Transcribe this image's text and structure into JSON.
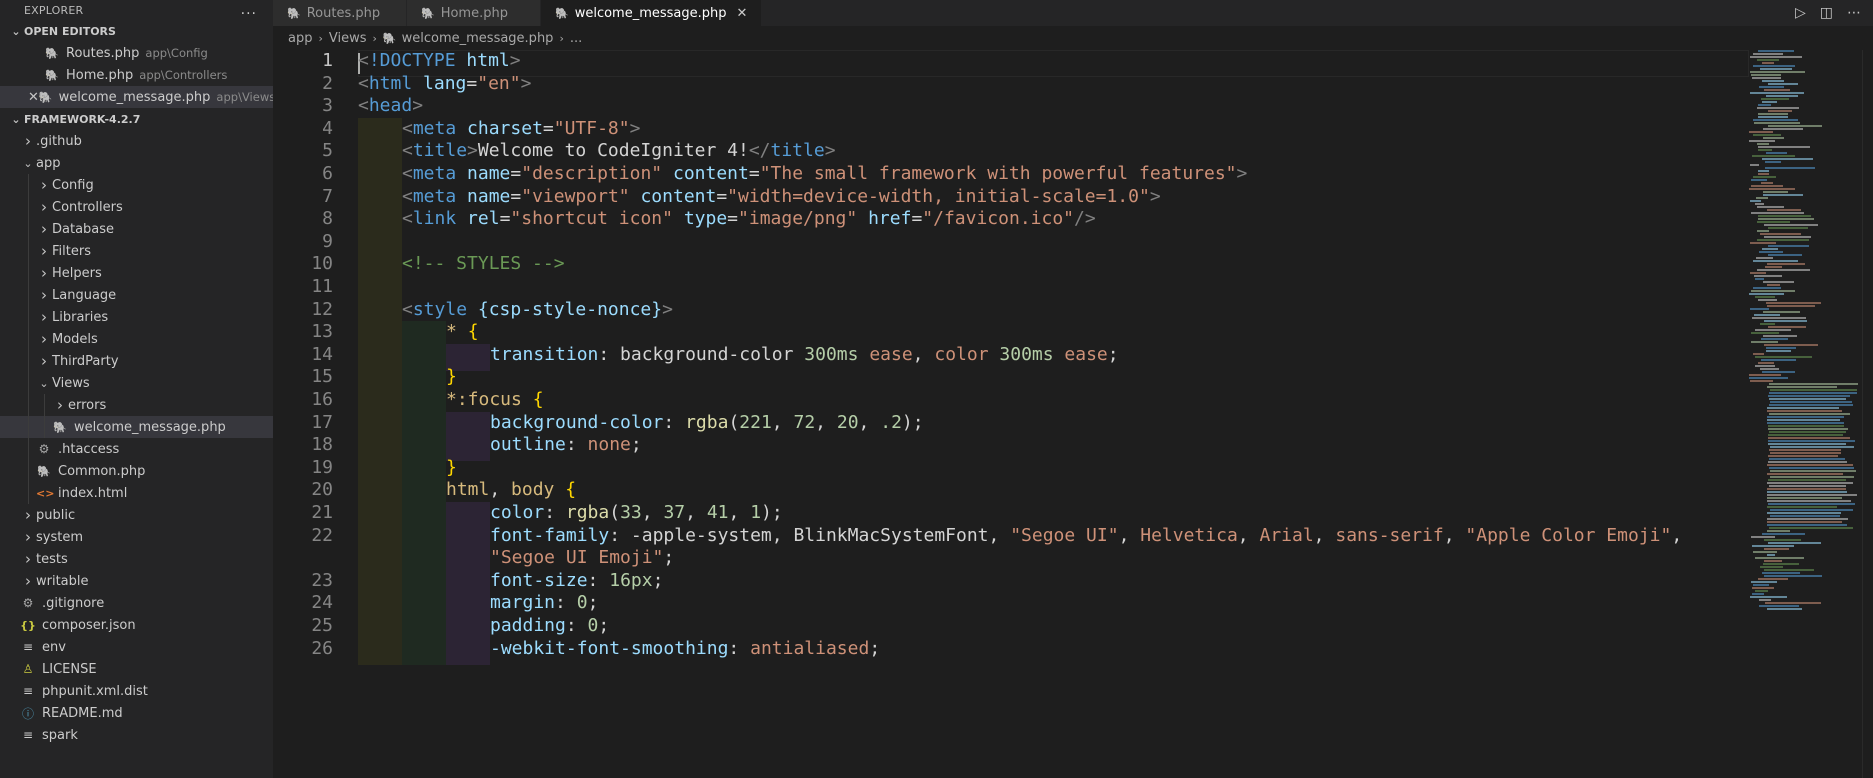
{
  "sidebar": {
    "title": "EXPLORER",
    "more_icon": "...",
    "open_editors": {
      "title": "OPEN EDITORS",
      "items": [
        {
          "name": "Routes.php",
          "path": "app\\Config",
          "icon": "php-icon"
        },
        {
          "name": "Home.php",
          "path": "app\\Controllers",
          "icon": "php-icon"
        },
        {
          "name": "welcome_message.php",
          "path": "app\\Views",
          "icon": "php-icon",
          "active": true
        }
      ]
    },
    "project": {
      "title": "FRAMEWORK-4.2.7",
      "tree": [
        {
          "label": ".github",
          "type": "folder",
          "depth": 0
        },
        {
          "label": "app",
          "type": "folder",
          "expanded": true,
          "depth": 0
        },
        {
          "label": "Config",
          "type": "folder",
          "depth": 1
        },
        {
          "label": "Controllers",
          "type": "folder",
          "depth": 1
        },
        {
          "label": "Database",
          "type": "folder",
          "depth": 1
        },
        {
          "label": "Filters",
          "type": "folder",
          "depth": 1
        },
        {
          "label": "Helpers",
          "type": "folder",
          "depth": 1
        },
        {
          "label": "Language",
          "type": "folder",
          "depth": 1
        },
        {
          "label": "Libraries",
          "type": "folder",
          "depth": 1
        },
        {
          "label": "Models",
          "type": "folder",
          "depth": 1
        },
        {
          "label": "ThirdParty",
          "type": "folder",
          "depth": 1
        },
        {
          "label": "Views",
          "type": "folder",
          "expanded": true,
          "depth": 1
        },
        {
          "label": "errors",
          "type": "folder",
          "depth": 2
        },
        {
          "label": "welcome_message.php",
          "type": "php",
          "depth": 2,
          "selected": true
        },
        {
          "label": ".htaccess",
          "type": "gear",
          "depth": 1
        },
        {
          "label": "Common.php",
          "type": "php",
          "depth": 1
        },
        {
          "label": "index.html",
          "type": "html",
          "depth": 1
        },
        {
          "label": "public",
          "type": "folder",
          "depth": 0
        },
        {
          "label": "system",
          "type": "folder",
          "depth": 0
        },
        {
          "label": "tests",
          "type": "folder",
          "depth": 0
        },
        {
          "label": "writable",
          "type": "folder",
          "depth": 0
        },
        {
          "label": ".gitignore",
          "type": "gear",
          "depth": 0
        },
        {
          "label": "composer.json",
          "type": "json",
          "depth": 0
        },
        {
          "label": "env",
          "type": "env",
          "depth": 0
        },
        {
          "label": "LICENSE",
          "type": "license",
          "depth": 0
        },
        {
          "label": "phpunit.xml.dist",
          "type": "xml",
          "depth": 0
        },
        {
          "label": "README.md",
          "type": "info",
          "depth": 0
        },
        {
          "label": "spark",
          "type": "env",
          "depth": 0
        }
      ]
    }
  },
  "tabs": [
    {
      "label": "Routes.php",
      "active": false
    },
    {
      "label": "Home.php",
      "active": false
    },
    {
      "label": "welcome_message.php",
      "active": true,
      "close": "✕"
    }
  ],
  "breadcrumb": [
    "app",
    "Views",
    "welcome_message.php",
    "..."
  ],
  "editor": {
    "active_line": 1,
    "lines": [
      {
        "n": "1",
        "indent": 0,
        "t": [
          [
            "br",
            "<"
          ],
          [
            "tag",
            "!DOCTYPE"
          ],
          [
            "txt",
            " "
          ],
          [
            "attr",
            "html"
          ],
          [
            "br",
            ">"
          ]
        ]
      },
      {
        "n": "2",
        "indent": 0,
        "t": [
          [
            "br",
            "<"
          ],
          [
            "tag",
            "html"
          ],
          [
            "txt",
            " "
          ],
          [
            "attr",
            "lang"
          ],
          [
            "txt",
            "="
          ],
          [
            "str",
            "\"en\""
          ],
          [
            "br",
            ">"
          ]
        ]
      },
      {
        "n": "3",
        "indent": 0,
        "t": [
          [
            "br",
            "<"
          ],
          [
            "tag",
            "head"
          ],
          [
            "br",
            ">"
          ]
        ]
      },
      {
        "n": "4",
        "indent": 1,
        "t": [
          [
            "br",
            "<"
          ],
          [
            "tag",
            "meta"
          ],
          [
            "txt",
            " "
          ],
          [
            "attr",
            "charset"
          ],
          [
            "txt",
            "="
          ],
          [
            "str",
            "\"UTF-8\""
          ],
          [
            "br",
            ">"
          ]
        ]
      },
      {
        "n": "5",
        "indent": 1,
        "t": [
          [
            "br",
            "<"
          ],
          [
            "tag",
            "title"
          ],
          [
            "br",
            ">"
          ],
          [
            "txt",
            "Welcome to CodeIgniter 4!"
          ],
          [
            "br",
            "</"
          ],
          [
            "tag",
            "title"
          ],
          [
            "br",
            ">"
          ]
        ]
      },
      {
        "n": "6",
        "indent": 1,
        "t": [
          [
            "br",
            "<"
          ],
          [
            "tag",
            "meta"
          ],
          [
            "txt",
            " "
          ],
          [
            "attr",
            "name"
          ],
          [
            "txt",
            "="
          ],
          [
            "str",
            "\"description\""
          ],
          [
            "txt",
            " "
          ],
          [
            "attr",
            "content"
          ],
          [
            "txt",
            "="
          ],
          [
            "str",
            "\"The small framework with powerful features\""
          ],
          [
            "br",
            ">"
          ]
        ]
      },
      {
        "n": "7",
        "indent": 1,
        "t": [
          [
            "br",
            "<"
          ],
          [
            "tag",
            "meta"
          ],
          [
            "txt",
            " "
          ],
          [
            "attr",
            "name"
          ],
          [
            "txt",
            "="
          ],
          [
            "str",
            "\"viewport\""
          ],
          [
            "txt",
            " "
          ],
          [
            "attr",
            "content"
          ],
          [
            "txt",
            "="
          ],
          [
            "str",
            "\"width=device-width, initial-scale=1.0\""
          ],
          [
            "br",
            ">"
          ]
        ]
      },
      {
        "n": "8",
        "indent": 1,
        "t": [
          [
            "br",
            "<"
          ],
          [
            "tag",
            "link"
          ],
          [
            "txt",
            " "
          ],
          [
            "attr",
            "rel"
          ],
          [
            "txt",
            "="
          ],
          [
            "str",
            "\"shortcut icon\""
          ],
          [
            "txt",
            " "
          ],
          [
            "attr",
            "type"
          ],
          [
            "txt",
            "="
          ],
          [
            "str",
            "\"image/png\""
          ],
          [
            "txt",
            " "
          ],
          [
            "attr",
            "href"
          ],
          [
            "txt",
            "="
          ],
          [
            "str",
            "\"/favicon.ico\""
          ],
          [
            "br",
            "/>"
          ]
        ]
      },
      {
        "n": "9",
        "indent": 1,
        "t": []
      },
      {
        "n": "10",
        "indent": 1,
        "t": [
          [
            "cmt",
            "<!-- STYLES -->"
          ]
        ]
      },
      {
        "n": "11",
        "indent": 1,
        "t": []
      },
      {
        "n": "12",
        "indent": 1,
        "t": [
          [
            "br",
            "<"
          ],
          [
            "tag",
            "style"
          ],
          [
            "txt",
            " "
          ],
          [
            "attr",
            "{csp-style-nonce}"
          ],
          [
            "br",
            ">"
          ]
        ]
      },
      {
        "n": "13",
        "indent": 2,
        "t": [
          [
            "sel",
            "*"
          ],
          [
            "txt",
            " "
          ],
          [
            "gold",
            "{"
          ]
        ]
      },
      {
        "n": "14",
        "indent": 3,
        "t": [
          [
            "attr",
            "transition"
          ],
          [
            "txt",
            ": background-color "
          ],
          [
            "num",
            "300ms"
          ],
          [
            "txt",
            " "
          ],
          [
            "str",
            "ease"
          ],
          [
            "txt",
            ", "
          ],
          [
            "str",
            "color"
          ],
          [
            "txt",
            " "
          ],
          [
            "num",
            "300ms"
          ],
          [
            "txt",
            " "
          ],
          [
            "str",
            "ease"
          ],
          [
            "txt",
            ";"
          ]
        ]
      },
      {
        "n": "15",
        "indent": 2,
        "t": [
          [
            "gold",
            "}"
          ]
        ]
      },
      {
        "n": "16",
        "indent": 2,
        "t": [
          [
            "sel",
            "*:focus"
          ],
          [
            "txt",
            " "
          ],
          [
            "gold",
            "{"
          ]
        ]
      },
      {
        "n": "17",
        "indent": 3,
        "t": [
          [
            "attr",
            "background-color"
          ],
          [
            "txt",
            ": "
          ],
          [
            "fn",
            "rgba"
          ],
          [
            "txt",
            "("
          ],
          [
            "num",
            "221"
          ],
          [
            "txt",
            ", "
          ],
          [
            "num",
            "72"
          ],
          [
            "txt",
            ", "
          ],
          [
            "num",
            "20"
          ],
          [
            "txt",
            ", "
          ],
          [
            "num",
            ".2"
          ],
          [
            "txt",
            ");"
          ]
        ]
      },
      {
        "n": "18",
        "indent": 3,
        "t": [
          [
            "attr",
            "outline"
          ],
          [
            "txt",
            ": "
          ],
          [
            "str",
            "none"
          ],
          [
            "txt",
            ";"
          ]
        ]
      },
      {
        "n": "19",
        "indent": 2,
        "t": [
          [
            "gold",
            "}"
          ]
        ]
      },
      {
        "n": "20",
        "indent": 2,
        "t": [
          [
            "sel",
            "html"
          ],
          [
            "txt",
            ", "
          ],
          [
            "sel",
            "body"
          ],
          [
            "txt",
            " "
          ],
          [
            "gold",
            "{"
          ]
        ]
      },
      {
        "n": "21",
        "indent": 3,
        "t": [
          [
            "attr",
            "color"
          ],
          [
            "txt",
            ": "
          ],
          [
            "fn",
            "rgba"
          ],
          [
            "txt",
            "("
          ],
          [
            "num",
            "33"
          ],
          [
            "txt",
            ", "
          ],
          [
            "num",
            "37"
          ],
          [
            "txt",
            ", "
          ],
          [
            "num",
            "41"
          ],
          [
            "txt",
            ", "
          ],
          [
            "num",
            "1"
          ],
          [
            "txt",
            ");"
          ]
        ]
      },
      {
        "n": "22",
        "indent": 3,
        "t": [
          [
            "attr",
            "font-family"
          ],
          [
            "txt",
            ": -apple-system, BlinkMacSystemFont, "
          ],
          [
            "str",
            "\"Segoe UI\""
          ],
          [
            "txt",
            ", "
          ],
          [
            "str",
            "Helvetica"
          ],
          [
            "txt",
            ", "
          ],
          [
            "str",
            "Arial"
          ],
          [
            "txt",
            ", "
          ],
          [
            "str",
            "sans-serif"
          ],
          [
            "txt",
            ", "
          ],
          [
            "str",
            "\"Apple Color Emoji\""
          ],
          [
            "txt",
            ","
          ]
        ]
      },
      {
        "n": "",
        "indent": 3,
        "t": [
          [
            "str",
            "\"Segoe UI Emoji\""
          ],
          [
            "txt",
            ";"
          ]
        ]
      },
      {
        "n": "23",
        "indent": 3,
        "t": [
          [
            "attr",
            "font-size"
          ],
          [
            "txt",
            ": "
          ],
          [
            "num",
            "16px"
          ],
          [
            "txt",
            ";"
          ]
        ]
      },
      {
        "n": "24",
        "indent": 3,
        "t": [
          [
            "attr",
            "margin"
          ],
          [
            "txt",
            ": "
          ],
          [
            "num",
            "0"
          ],
          [
            "txt",
            ";"
          ]
        ]
      },
      {
        "n": "25",
        "indent": 3,
        "t": [
          [
            "attr",
            "padding"
          ],
          [
            "txt",
            ": "
          ],
          [
            "num",
            "0"
          ],
          [
            "txt",
            ";"
          ]
        ]
      },
      {
        "n": "26",
        "indent": 3,
        "t": [
          [
            "attr",
            "-webkit-font-smoothing"
          ],
          [
            "txt",
            ": "
          ],
          [
            "str",
            "antialiased"
          ],
          [
            "txt",
            ";"
          ]
        ]
      }
    ]
  },
  "colors": {
    "tag": "#569cd6",
    "attribute": "#9cdcfe",
    "string": "#ce9178",
    "comment": "#6a9955",
    "number": "#b5cea8",
    "function": "#dcdcaa",
    "bracket": "#ffd700",
    "selector": "#d7ba7d"
  }
}
